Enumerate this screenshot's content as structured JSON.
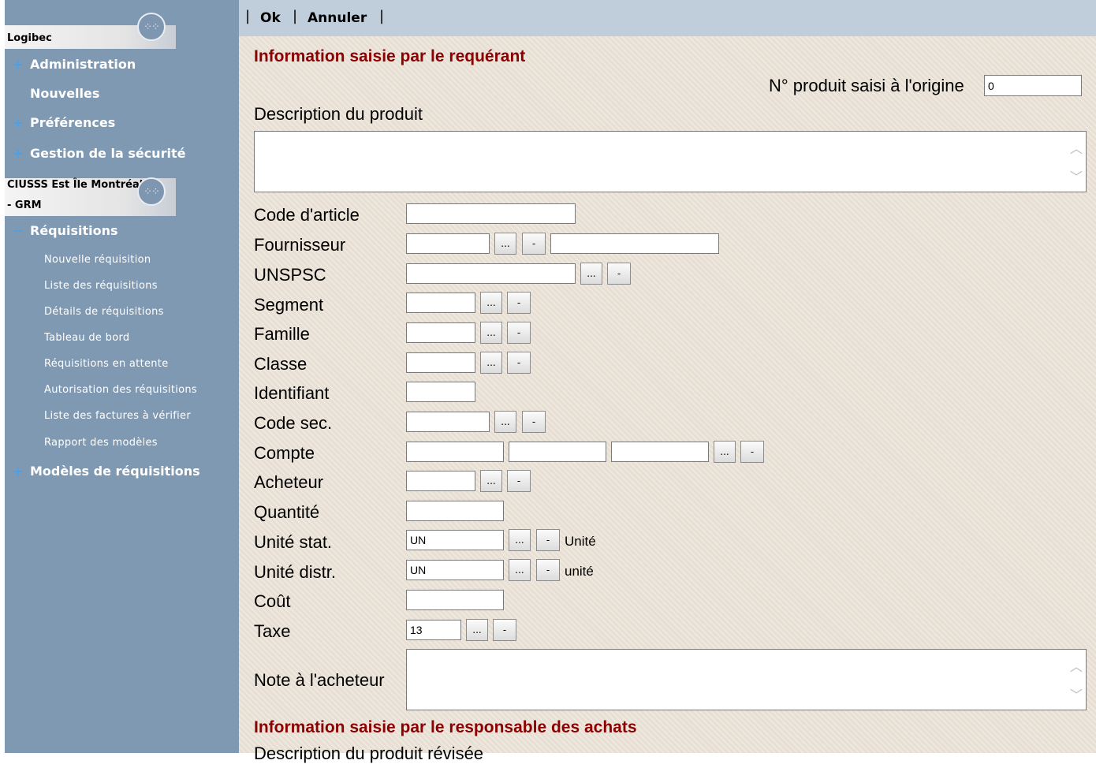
{
  "sidebar": {
    "section1_title": "Logibec",
    "section2_title": "CIUSSS Est Île Montréal",
    "section2_sub": "- GRM",
    "items": [
      {
        "expander": "+",
        "label": "Administration"
      },
      {
        "expander": "",
        "label": "Nouvelles"
      },
      {
        "expander": "+",
        "label": "Préférences"
      },
      {
        "expander": "+",
        "label": "Gestion de la sécurité"
      },
      {
        "expander": "−",
        "label": "Réquisitions"
      },
      {
        "expander": "+",
        "label": "Modèles de réquisitions"
      }
    ],
    "sub_items": [
      "Nouvelle réquisition",
      "Liste des réquisitions",
      "Détails de réquisitions",
      "Tableau de bord",
      "Réquisitions en attente",
      "Autorisation des réquisitions",
      "Liste des factures à vérifier",
      "Rapport des modèles"
    ]
  },
  "toolbar": {
    "sep": "|",
    "ok_label": "Ok",
    "cancel_label": "Annuler"
  },
  "form": {
    "section1_title": "Information saisie par le requérant",
    "orig_product_label": "N° produit saisi à l'origine",
    "orig_product_value": "0",
    "description_label": "Description du produit",
    "labels": {
      "code_article": "Code d'article",
      "fournisseur": "Fournisseur",
      "unspsc": "UNSPSC",
      "segment": "Segment",
      "famille": "Famille",
      "classe": "Classe",
      "identifiant": "Identifiant",
      "code_sec": "Code sec.",
      "compte": "Compte",
      "acheteur": "Acheteur",
      "quantite": "Quantité",
      "unite_stat": "Unité stat.",
      "unite_distr": "Unité distr.",
      "cout": "Coût",
      "taxe": "Taxe",
      "note_acheteur": "Note à l'acheteur"
    },
    "values": {
      "unite_stat": "UN",
      "unite_distr": "UN",
      "taxe": "13"
    },
    "unit_stat_desc": "Unité",
    "unit_distr_desc": "unité",
    "lookup_btn": "...",
    "clear_btn": "-",
    "section2_title": "Information saisie par le responsable des achats",
    "revised_desc_label": "Description du produit révisée"
  }
}
